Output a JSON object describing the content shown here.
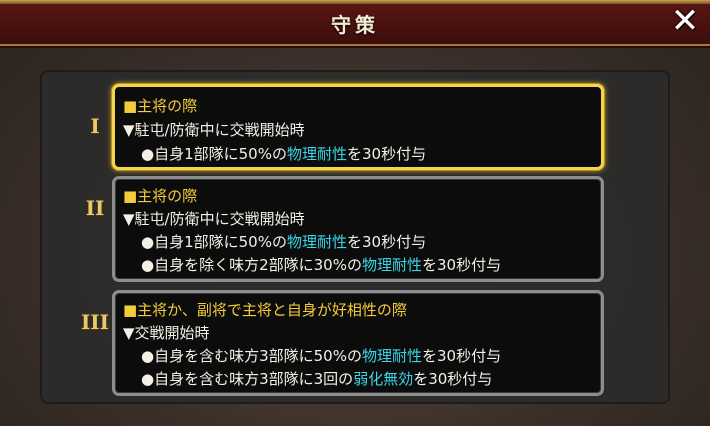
{
  "header": {
    "title": "守策"
  },
  "policies": [
    {
      "numeral": "I",
      "condition": "■主将の際",
      "trigger": "▼駐屯/防衛中に交戦開始時",
      "effects": [
        {
          "pre": "●自身1部隊に50%の",
          "hl": "物理耐性",
          "post": "を30秒付与"
        }
      ]
    },
    {
      "numeral": "II",
      "condition": "■主将の際",
      "trigger": "▼駐屯/防衛中に交戦開始時",
      "effects": [
        {
          "pre": "●自身1部隊に50%の",
          "hl": "物理耐性",
          "post": "を30秒付与"
        },
        {
          "pre": "●自身を除く味方2部隊に30%の",
          "hl": "物理耐性",
          "post": "を30秒付与"
        }
      ]
    },
    {
      "numeral": "III",
      "condition": "■主将か、副将で主将と自身が好相性の際",
      "trigger": "▼交戦開始時",
      "effects": [
        {
          "pre": "●自身を含む味方3部隊に50%の",
          "hl": "物理耐性",
          "post": "を30秒付与"
        },
        {
          "pre": "●自身を含む味方3部隊に3回の",
          "hl": "弱化無効",
          "post": "を30秒付与"
        }
      ]
    }
  ]
}
